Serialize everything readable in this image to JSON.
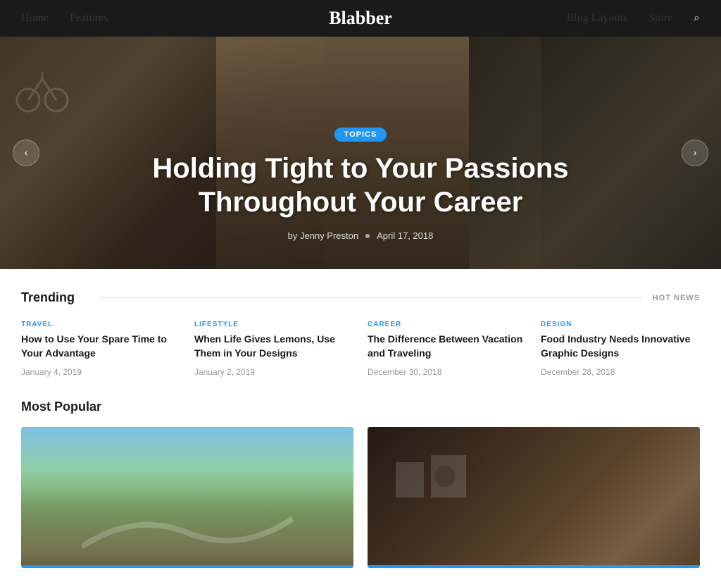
{
  "nav": {
    "logo": "Blabber",
    "links": [
      {
        "label": "Home",
        "id": "home"
      },
      {
        "label": "Features",
        "id": "features"
      },
      {
        "label": "Blog Layouts",
        "id": "blog-layouts"
      },
      {
        "label": "Store",
        "id": "store"
      }
    ],
    "search_icon": "🔍"
  },
  "hero": {
    "tag": "TOPICS",
    "title": "Holding Tight to Your Passions Throughout Your Career",
    "author": "by Jenny Preston",
    "date": "April 17, 2018",
    "prev_label": "‹",
    "next_label": "›"
  },
  "trending": {
    "section_title": "Trending",
    "hot_news_label": "HOT NEWS",
    "cards": [
      {
        "category": "TRAVEL",
        "category_class": "cat-travel",
        "title": "How to Use Your Spare Time to Your Advantage",
        "date": "January 4, 2019"
      },
      {
        "category": "LIFESTYLE",
        "category_class": "cat-lifestyle",
        "title": "When Life Gives Lemons, Use Them in Your Designs",
        "date": "January 2, 2019"
      },
      {
        "category": "CAREER",
        "category_class": "cat-career",
        "title": "The Difference Between Vacation and Traveling",
        "date": "December 30, 2018"
      },
      {
        "category": "DESIGN",
        "category_class": "cat-design",
        "title": "Food Industry Needs Innovative Graphic Designs",
        "date": "December 28, 2018"
      }
    ]
  },
  "popular": {
    "section_title": "Most Popular",
    "cards": [
      {
        "id": "running",
        "bg_class": "popular-card-bg-run",
        "overlay_class": "run-overlay"
      },
      {
        "id": "craft",
        "bg_class": "popular-card-bg-craft",
        "overlay_class": "craft-overlay"
      }
    ]
  }
}
